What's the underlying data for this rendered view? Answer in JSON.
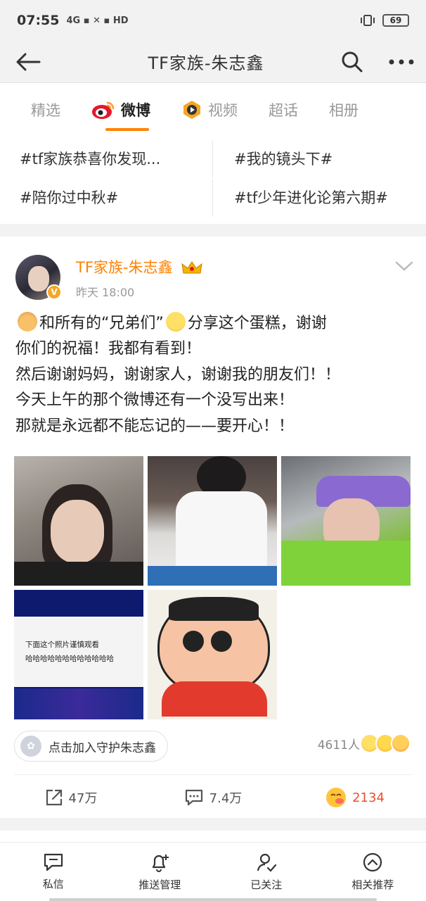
{
  "status_bar": {
    "time": "07:55",
    "indicators": "4G ▪ ✕ ▪ HD",
    "battery": "69"
  },
  "header": {
    "title": "TF家族-朱志鑫"
  },
  "tabs": [
    {
      "label": "精选"
    },
    {
      "label": "微博"
    },
    {
      "label": "视频"
    },
    {
      "label": "超话"
    },
    {
      "label": "相册"
    }
  ],
  "topics": [
    "#tf家族恭喜你发现...",
    "#我的镜头下#",
    "#陪你过中秋#",
    "#tf少年进化论第六期#"
  ],
  "post": {
    "author": "TF家族-朱志鑫",
    "time": "昨天 18:00",
    "verified_badge": "V",
    "text_lines": {
      "l1_a": "和所有的“兄弟们”",
      "l1_b": "分享这个蛋糕，谢谢",
      "l2": "你们的祝福！我都有看到！",
      "l3": "然后谢谢妈妈，谢谢家人，谢谢我的朋友们！！",
      "l4": "今天上午的那个微博还有一个没写出来！",
      "l5": "那就是永远都不能忘记的——要开心！！"
    },
    "photo4_text": {
      "line1": "下面这个照片谨慎观看",
      "line2": "哈哈哈哈哈哈哈哈哈哈哈哈"
    },
    "guard_label": "点击加入守护朱志鑫",
    "reaction_count": "4611人",
    "actions": {
      "repost": "47万",
      "comment": "7.4万",
      "like": "2134"
    }
  },
  "bottom_nav": [
    {
      "label": "私信"
    },
    {
      "label": "推送管理"
    },
    {
      "label": "已关注"
    },
    {
      "label": "相关推荐"
    }
  ],
  "colors": {
    "accent": "#ff8200",
    "like": "#e8502f"
  }
}
